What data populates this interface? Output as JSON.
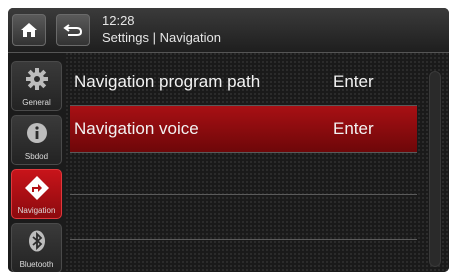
{
  "header": {
    "time": "12:28",
    "breadcrumb": "Settings | Navigation",
    "home_icon": "home-icon",
    "back_icon": "back-arrow-icon"
  },
  "sidebar": {
    "items": [
      {
        "label": "General",
        "icon": "gear-icon",
        "active": false
      },
      {
        "label": "Sbdod",
        "icon": "info-icon",
        "active": false
      },
      {
        "label": "Navigation",
        "icon": "navigation-arrow-icon",
        "active": true
      },
      {
        "label": "Bluetooth",
        "icon": "bluetooth-icon",
        "active": false
      }
    ]
  },
  "settings": {
    "rows": [
      {
        "label": "Navigation program path",
        "value": "Enter",
        "selected": false
      },
      {
        "label": "Navigation voice",
        "value": "Enter",
        "selected": true
      }
    ]
  },
  "colors": {
    "accent": "#a81014",
    "background": "#1a1a1a",
    "text": "#f2f2f2"
  }
}
